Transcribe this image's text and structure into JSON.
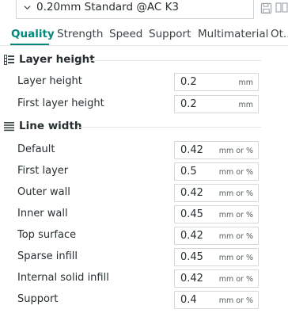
{
  "preset": {
    "name": "0.20mm Standard @AC K3"
  },
  "tabs": [
    {
      "label": "Quality"
    },
    {
      "label": "Strength"
    },
    {
      "label": "Speed"
    },
    {
      "label": "Support"
    },
    {
      "label": "Multimaterial"
    },
    {
      "label": "Ot.."
    }
  ],
  "active_tab": "Quality",
  "colors": {
    "accent": "#00897b",
    "text": "#262e30",
    "border": "#d4d7d9"
  },
  "sections": {
    "layer_height": {
      "title": "Layer height",
      "icon": "layer-height-icon",
      "rows": [
        {
          "label": "Layer height",
          "value": "0.2",
          "unit": "mm"
        },
        {
          "label": "First layer height",
          "value": "0.2",
          "unit": "mm"
        }
      ]
    },
    "line_width": {
      "title": "Line width",
      "icon": "line-width-icon",
      "rows": [
        {
          "label": "Default",
          "value": "0.42",
          "unit": "mm or %"
        },
        {
          "label": "First layer",
          "value": "0.5",
          "unit": "mm or %"
        },
        {
          "label": "Outer wall",
          "value": "0.42",
          "unit": "mm or %"
        },
        {
          "label": "Inner wall",
          "value": "0.45",
          "unit": "mm or %"
        },
        {
          "label": "Top surface",
          "value": "0.42",
          "unit": "mm or %"
        },
        {
          "label": "Sparse infill",
          "value": "0.45",
          "unit": "mm or %"
        },
        {
          "label": "Internal solid infill",
          "value": "0.42",
          "unit": "mm or %"
        },
        {
          "label": "Support",
          "value": "0.4",
          "unit": "mm or %"
        }
      ]
    }
  }
}
